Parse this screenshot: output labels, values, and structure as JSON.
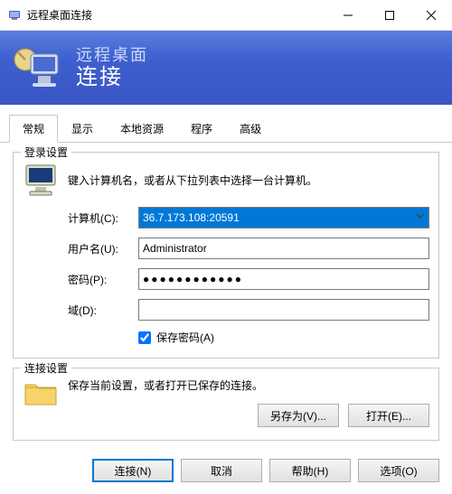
{
  "window": {
    "title": "远程桌面连接"
  },
  "banner": {
    "subtitle": "远程桌面",
    "heading": "连接"
  },
  "tabs": {
    "general": "常规",
    "display": "显示",
    "local": "本地资源",
    "programs": "程序",
    "advanced": "高级"
  },
  "login": {
    "legend": "登录设置",
    "instruction": "键入计算机名，或者从下拉列表中选择一台计算机。",
    "computer_label": "计算机(C):",
    "computer_value": "36.7.173.108:20591",
    "user_label": "用户名(U):",
    "user_value": "Administrator",
    "password_label": "密码(P):",
    "password_value": "●●●●●●●●●●●●",
    "domain_label": "域(D):",
    "domain_value": "",
    "save_pw_label": "保存密码(A)"
  },
  "conn": {
    "legend": "连接设置",
    "instruction": "保存当前设置，或者打开已保存的连接。",
    "save_as": "另存为(V)...",
    "open": "打开(E)..."
  },
  "footer": {
    "connect": "连接(N)",
    "cancel": "取消",
    "help": "帮助(H)",
    "options": "选项(O)"
  }
}
